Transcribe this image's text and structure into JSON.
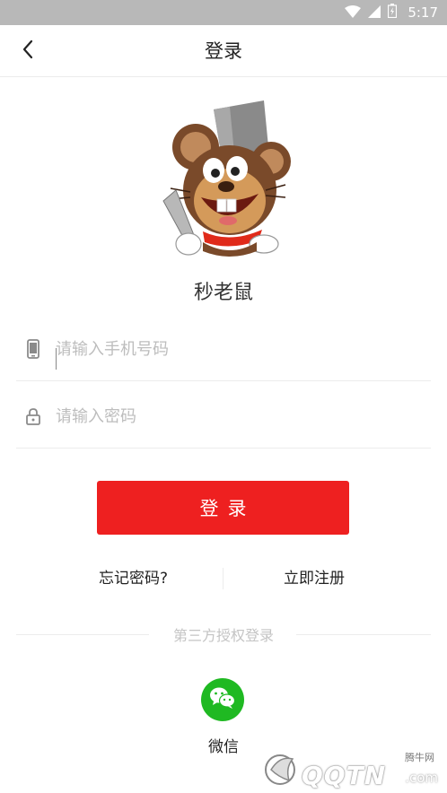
{
  "status_bar": {
    "time": "5:17",
    "icons": [
      "wifi-icon",
      "cellular-signal-icon",
      "battery-icon"
    ]
  },
  "header": {
    "title": "登录",
    "back_icon": "chevron-left-icon"
  },
  "brand": {
    "app_name": "秒老鼠",
    "mascot": "mouse-mascot-logo"
  },
  "form": {
    "phone": {
      "placeholder": "请输入手机号码",
      "value": "",
      "icon": "phone-icon"
    },
    "password": {
      "placeholder": "请输入密码",
      "value": "",
      "icon": "lock-icon"
    },
    "login_label": "登录"
  },
  "links": {
    "forgot": "忘记密码?",
    "register": "立即注册"
  },
  "third_party": {
    "label": "第三方授权登录",
    "wechat_label": "微信",
    "wechat_icon": "wechat-icon"
  },
  "watermark": {
    "small": "腾牛网",
    "main": "QQTN",
    "suffix": ".com"
  },
  "colors": {
    "accent": "#ee2020",
    "wechat": "#1fb922",
    "status_bar": "#b8b8b8"
  }
}
